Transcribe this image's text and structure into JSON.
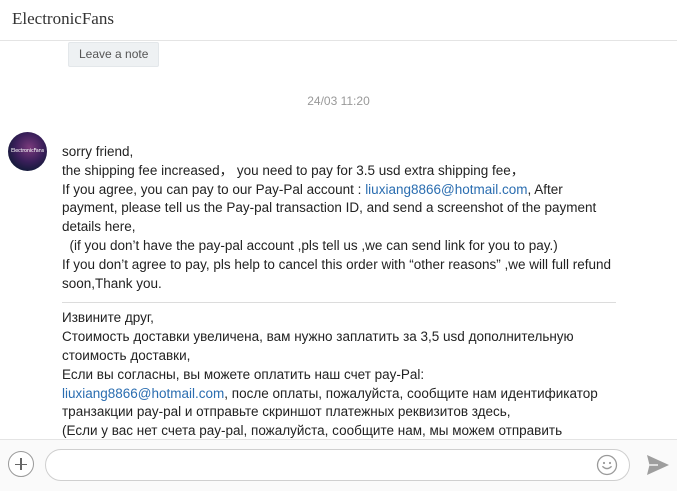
{
  "header": {
    "title": "ElectronicFans"
  },
  "chat": {
    "leave_note_label": "Leave a note",
    "timestamp": "24/03 11:20",
    "avatar_label": "ElectronicFans",
    "message": {
      "en": {
        "line1": "sorry friend,",
        "line2": "the shipping fee increased， you need to pay for 3.5 usd extra shipping fee，",
        "line3a": "If you agree, you can pay to our Pay-Pal account : ",
        "email": "liuxiang8866@hotmail.com",
        "line3b": ", After payment, please tell us the Pay-pal transaction ID, and send a screenshot of the payment details here,",
        "line4": "  (if you don’t have the pay-pal account ,pls tell us ,we can send link for you to pay.)",
        "line5": "If you don’t agree to pay, pls help to cancel this order with “other reasons” ,we will full refund soon,Thank you."
      },
      "ru": {
        "line1": "Извините друг,",
        "line2": "Стоимость доставки увеличена, вам нужно заплатить за 3,5 usd дополнительную стоимость доставки,",
        "line3": "Если вы согласны, вы можете оплатить наш счет pay-Pal:",
        "email": "liuxiang8866@hotmail.com",
        "line4b": ", после оплаты, пожалуйста, сообщите нам идентификатор транзакции pay-pal и отправьте скриншот платежных реквизитов здесь,",
        "line5": "(Если у вас нет счета pay-pal, пожалуйста, сообщите нам, мы можем отправить"
      }
    }
  },
  "composer": {
    "placeholder": ""
  },
  "colors": {
    "link": "#2a6db0",
    "send_icon": "#9e9e9e"
  },
  "icons": {
    "add": "plus-icon",
    "emoji": "emoji-icon",
    "send": "send-icon"
  }
}
